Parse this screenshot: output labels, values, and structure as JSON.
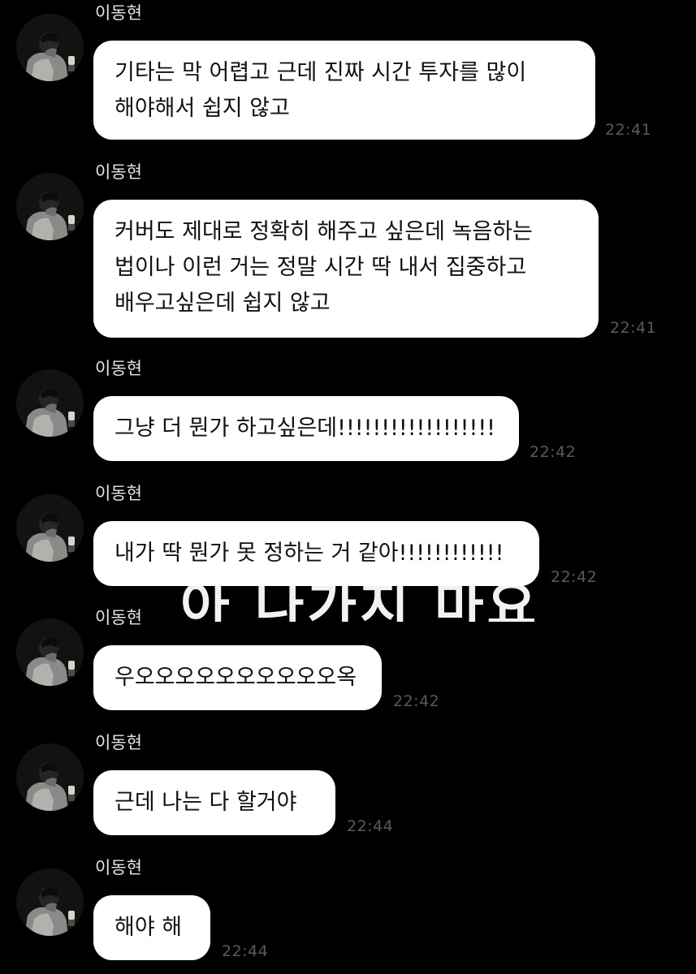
{
  "overlay_caption": "아 나가지 마요",
  "messages": [
    {
      "sender": "이동현",
      "lines": [
        "기타는 막 어렵고 근데 진짜 시간 투자를 많이",
        "해야해서 쉽지 않고"
      ],
      "time": "22:41"
    },
    {
      "sender": "이동현",
      "lines": [
        "커버도 제대로 정확히 해주고 싶은데 녹음하는",
        "법이나 이런 거는 정말 시간 딱 내서 집중하고",
        "배우고싶은데 쉽지 않고"
      ],
      "time": "22:41"
    },
    {
      "sender": "이동현",
      "lines": [
        "그냥 더 뭔가 하고싶은데!!!!!!!!!!!!!!!!!!"
      ],
      "time": "22:42"
    },
    {
      "sender": "이동현",
      "lines": [
        "내가 딱 뭔가 못 정하는 거 같아!!!!!!!!!!!!"
      ],
      "time": "22:42"
    },
    {
      "sender": "이동현",
      "lines": [
        "우오오오오오오오오오오옥"
      ],
      "time": "22:42"
    },
    {
      "sender": "이동현",
      "lines": [
        "근데 나는 다 할거야"
      ],
      "time": "22:44"
    },
    {
      "sender": "이동현",
      "lines": [
        "해야 해"
      ],
      "time": "22:44"
    }
  ]
}
